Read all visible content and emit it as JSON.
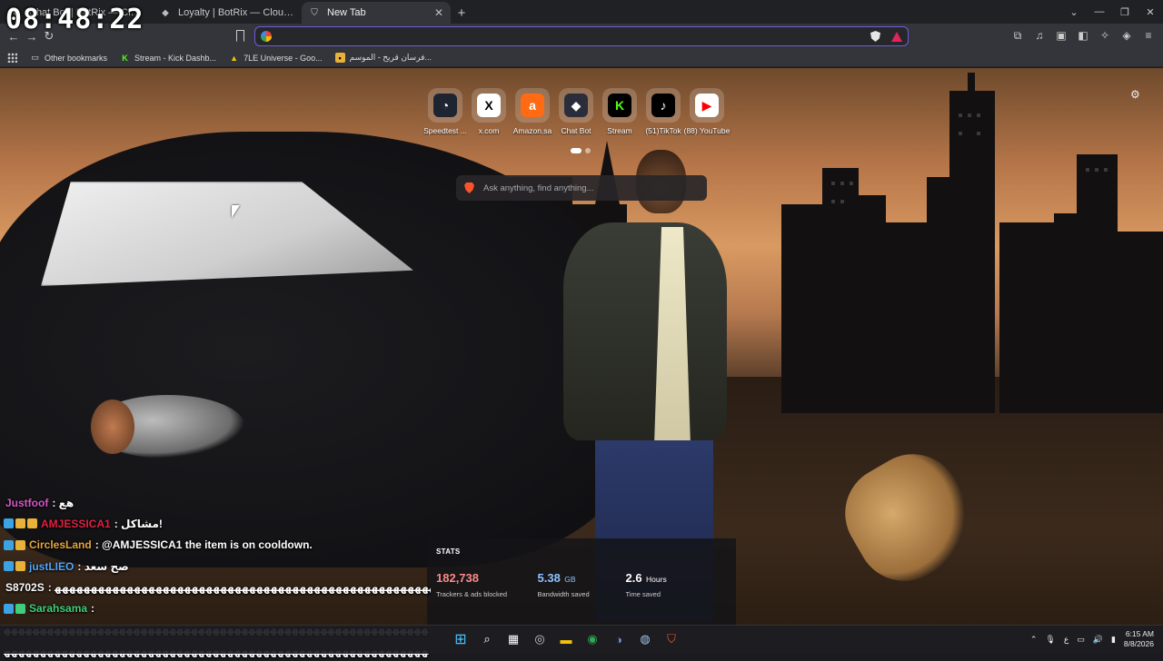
{
  "overlay": {
    "clock": "08:48:22"
  },
  "tabs": [
    {
      "label": "Chat Bot | BotRix — Cloud Streaming",
      "favicon": "botrix-icon",
      "active": false
    },
    {
      "label": "Loyalty | BotRix — Cloud Streaming B",
      "favicon": "botrix-icon",
      "active": false
    },
    {
      "label": "New Tab",
      "favicon": "brave-icon",
      "active": true
    }
  ],
  "toolbar": {
    "address_value": "",
    "address_placeholder": ""
  },
  "bookmarks": [
    {
      "label": "Other bookmarks",
      "icon": "folder-icon"
    },
    {
      "label": "Stream - Kick Dashb...",
      "icon": "kick-icon"
    },
    {
      "label": "7LE Universe - Goo...",
      "icon": "drive-icon"
    },
    {
      "label": "فرسان قريح - الموسم...",
      "icon": "page-icon"
    }
  ],
  "top_sites": [
    {
      "label": "Speedtest ...",
      "icon": "speedtest-icon",
      "bg": "#1f2433",
      "fg": "#fff",
      "glyph": "◔"
    },
    {
      "label": "x.com",
      "icon": "x-icon",
      "bg": "#ffffff",
      "fg": "#000",
      "glyph": "X"
    },
    {
      "label": "Amazon.sa",
      "icon": "amazon-icon",
      "bg": "#ff6a13",
      "fg": "#fff",
      "glyph": "a"
    },
    {
      "label": "Chat Bot",
      "icon": "botrix-icon",
      "bg": "#2a2d3a",
      "fg": "#fff",
      "glyph": "◆"
    },
    {
      "label": "Stream",
      "icon": "kick-icon",
      "bg": "#000000",
      "fg": "#53fc18",
      "glyph": "K"
    },
    {
      "label": "(51)TikTok",
      "icon": "tiktok-icon",
      "bg": "#000000",
      "fg": "#fff",
      "glyph": "♪"
    },
    {
      "label": "(88) YouTube",
      "icon": "youtube-icon",
      "bg": "#ffffff",
      "fg": "#ff0000",
      "glyph": "▶"
    }
  ],
  "search": {
    "placeholder": "Ask anything, find anything..."
  },
  "stats": {
    "title": "STATS",
    "trackers": {
      "value": "182,738",
      "unit": "",
      "caption": "Trackers & ads blocked",
      "color": "#fb8a8a"
    },
    "bandwidth": {
      "value": "5.38",
      "unit": "GB",
      "caption": "Bandwidth saved",
      "color": "#8fc2ff"
    },
    "time": {
      "value": "2.6",
      "unit": "Hours",
      "caption": "Time saved",
      "color": "#ffffff"
    }
  },
  "chat": [
    {
      "name": "Justfoof",
      "color": "#d457c8",
      "badges": [],
      "text": ": هع"
    },
    {
      "name": "AMJESSICA1",
      "color": "#e02040",
      "badges": [
        "b-blue",
        "b-gold",
        "b-gold"
      ],
      "text": ": مشاكل!"
    },
    {
      "name": "CirclesLand",
      "color": "#e6a63a",
      "badges": [
        "b-blue",
        "b-gold"
      ],
      "text": ": @AMJESSICA1 the item is on cooldown."
    },
    {
      "name": "justLIEO",
      "color": "#4fa7ff",
      "badges": [
        "b-blue",
        "b-gold"
      ],
      "text": ": صح سعد"
    },
    {
      "name": "S8702S",
      "color": "#ffffff",
      "badges": [],
      "text": ": ﻬﻬﻬﻬﻬﻬﻬﻬﻬﻬﻬﻬﻬﻬﻬﻬﻬﻬﻬﻬﻬﻬﻬﻬﻬﻬﻬﻬﻬﻬﻬﻬﻬﻬﻬﻬﻬﻬﻬﻬﻬﻬﻬﻬﻬﻬﻬﻬﻬﻬﻬﻬﻬﻬ"
    },
    {
      "name": "Sarahsama",
      "color": "#3fcf7a",
      "badges": [
        "b-blue",
        "b-green"
      ],
      "text": ":"
    },
    {
      "name": "",
      "color": "#ffffff",
      "badges": [],
      "text": "ﻬﻬﻬﻬﻬﻬﻬﻬﻬﻬﻬﻬﻬﻬﻬﻬﻬﻬﻬﻬﻬﻬﻬﻬﻬﻬﻬﻬﻬﻬﻬﻬﻬﻬﻬﻬﻬﻬﻬﻬﻬﻬﻬﻬﻬﻬﻬﻬﻬﻬﻬﻬﻬﻬﻬﻬﻬﻬﻬ"
    },
    {
      "name": "",
      "color": "#ffffff",
      "badges": [],
      "text": "ﻬﻬﻬﻬﻬﻬﻬﻬﻬﻬﻬﻬﻬﻬﻬﻬﻬﻬﻬﻬﻬﻬﻬﻬﻬﻬﻬﻬﻬﻬﻬﻬﻬﻬﻬﻬﻬﻬﻬﻬﻬﻬﻬﻬﻬﻬﻬﻬﻬﻬﻬﻬﻬﻬﻬﻬﻬﻬﻬ"
    }
  ],
  "taskbar": {
    "apps": [
      "windows-start-icon",
      "search-icon",
      "store-icon",
      "chrome-dev-icon",
      "file-explorer-icon",
      "chrome-icon",
      "discord-icon",
      "steam-icon",
      "brave-icon"
    ],
    "lang": "ع",
    "time": "6:15 AM",
    "date": "8/8/2026"
  }
}
